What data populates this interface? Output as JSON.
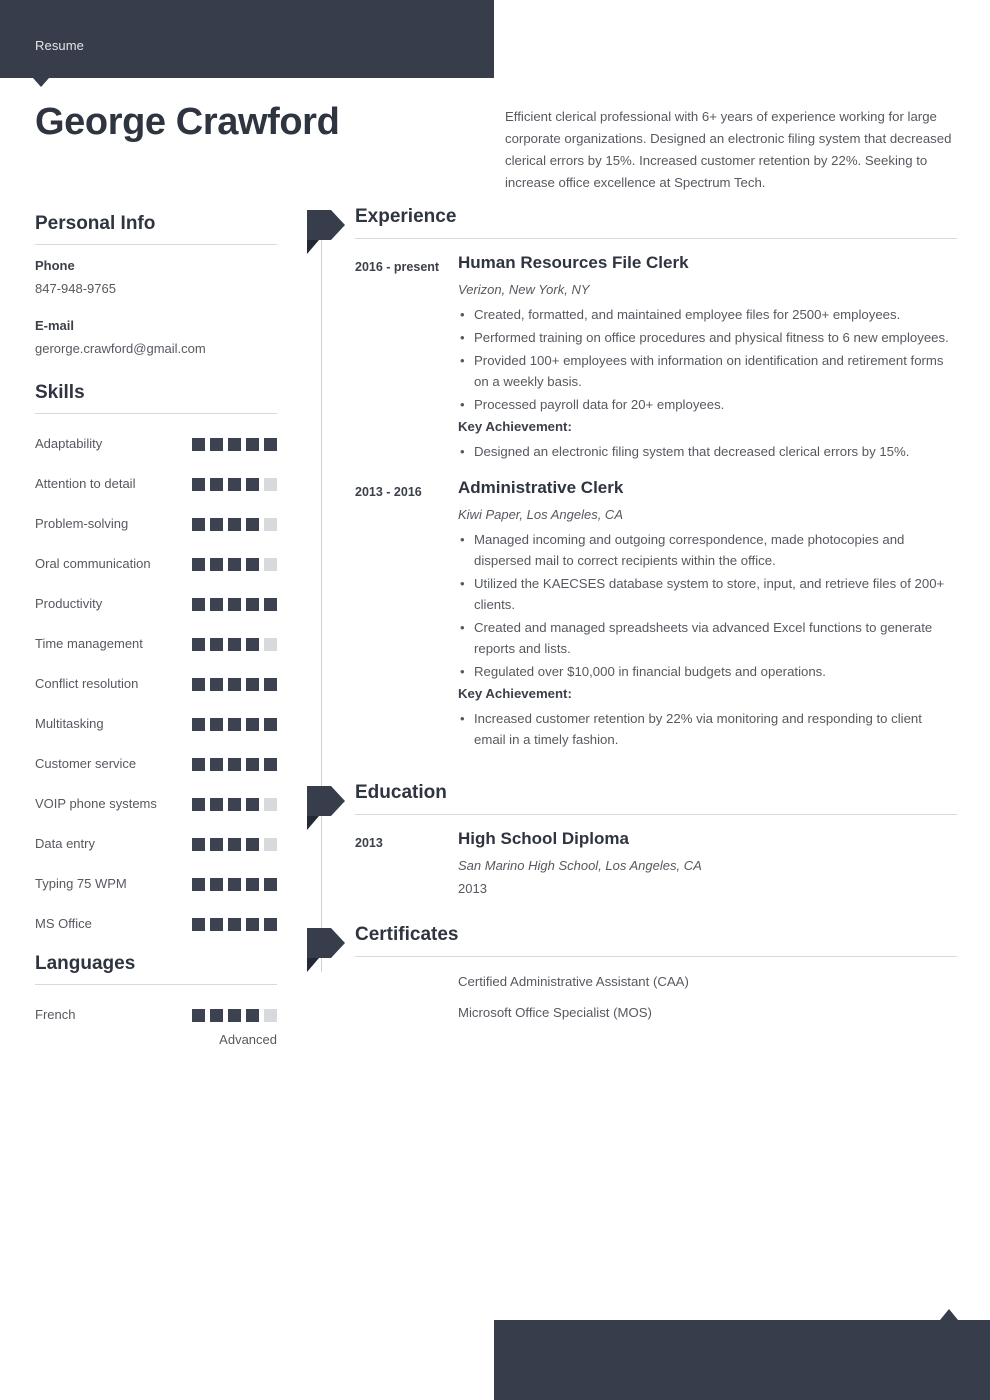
{
  "topbar": {
    "label": "Resume"
  },
  "header": {
    "name": "George Crawford",
    "summary": "Efficient clerical professional with 6+ years of experience working for large corporate organizations. Designed an electronic filing system that decreased clerical errors by 15%. Increased customer retention by 22%. Seeking to increase office excellence at Spectrum Tech."
  },
  "personal_info": {
    "heading": "Personal Info",
    "phone_label": "Phone",
    "phone_value": "847-948-9765",
    "email_label": "E-mail",
    "email_value": "gerorge.crawford@gmail.com"
  },
  "skills": {
    "heading": "Skills",
    "max": 5,
    "items": [
      {
        "name": "Adaptability",
        "level": 5
      },
      {
        "name": "Attention to detail",
        "level": 4
      },
      {
        "name": "Problem-solving",
        "level": 4
      },
      {
        "name": "Oral communication",
        "level": 4
      },
      {
        "name": "Productivity",
        "level": 5
      },
      {
        "name": "Time management",
        "level": 4
      },
      {
        "name": "Conflict resolution",
        "level": 5
      },
      {
        "name": "Multitasking",
        "level": 5
      },
      {
        "name": "Customer service",
        "level": 5
      },
      {
        "name": "VOIP phone systems",
        "level": 4
      },
      {
        "name": "Data entry",
        "level": 4
      },
      {
        "name": "Typing 75 WPM",
        "level": 5
      },
      {
        "name": "MS Office",
        "level": 5
      }
    ]
  },
  "languages": {
    "heading": "Languages",
    "max": 5,
    "items": [
      {
        "name": "French",
        "level": 4,
        "proficiency": "Advanced"
      }
    ]
  },
  "experience": {
    "heading": "Experience",
    "entries": [
      {
        "date": "2016 - present",
        "title": "Human Resources File Clerk",
        "meta": "Verizon, New York, NY",
        "bullets": [
          "Created, formatted, and maintained employee files for 2500+ employees.",
          "Performed training on office procedures and physical fitness to 6 new employees.",
          "Provided 100+ employees with information on identification and retirement forms on a weekly basis.",
          "Processed payroll data for 20+ employees."
        ],
        "key_achievement_label": "Key Achievement:",
        "key_achievements": [
          "Designed an electronic filing system that decreased clerical errors by 15%."
        ]
      },
      {
        "date": "2013 - 2016",
        "title": "Administrative Clerk",
        "meta": "Kiwi Paper, Los Angeles, CA",
        "bullets": [
          "Managed incoming and outgoing correspondence, made photocopies and dispersed mail to correct recipients within the office.",
          "Utilized the KAECSES database system to store, input, and retrieve files of 200+ clients.",
          "Created and managed spreadsheets via advanced Excel functions to generate reports and lists.",
          "Regulated over $10,000 in financial budgets and operations."
        ],
        "key_achievement_label": "Key Achievement:",
        "key_achievements": [
          "Increased customer retention by 22% via monitoring and responding to client email in a timely fashion."
        ]
      }
    ]
  },
  "education": {
    "heading": "Education",
    "entries": [
      {
        "date": "2013",
        "title": "High School Diploma",
        "meta": "San Marino High School, Los Angeles, CA",
        "year": "2013"
      }
    ]
  },
  "certificates": {
    "heading": "Certificates",
    "items": [
      "Certified Administrative Assistant (CAA)",
      "Microsoft Office Specialist (MOS)"
    ]
  },
  "colors": {
    "dark_navy": "#373d4b",
    "flag_tail": "#242936",
    "heading": "#2e3440",
    "body_text": "#55595f",
    "dot_on": "#3c4250",
    "dot_off": "#d7d9dc",
    "rule": "#d7d9dc"
  }
}
